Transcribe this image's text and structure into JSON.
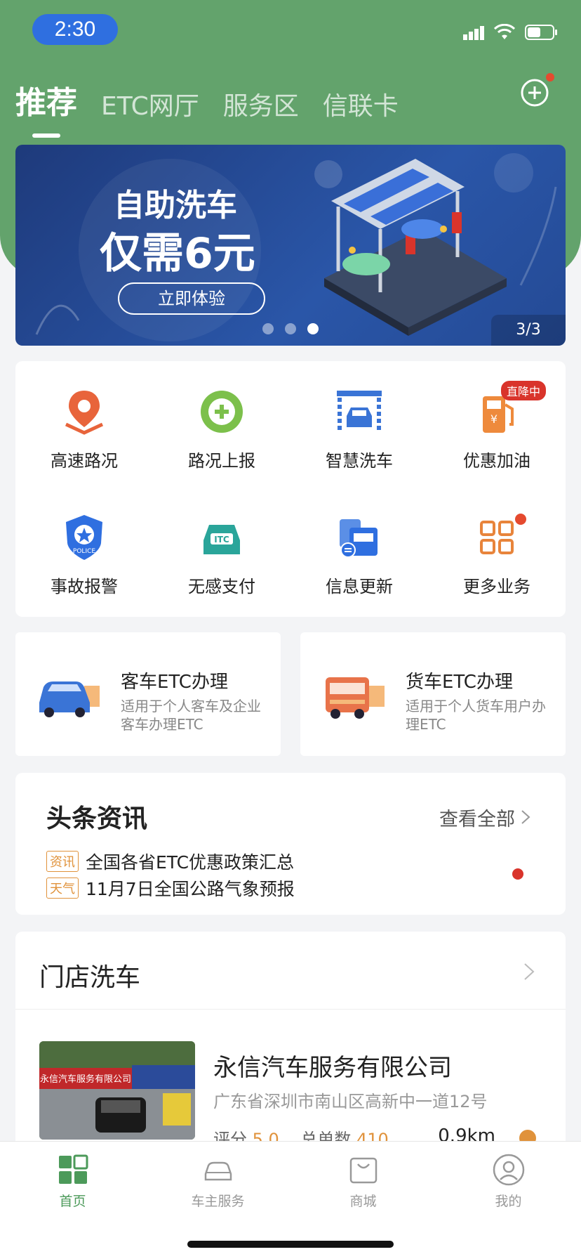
{
  "status": {
    "time": "2:30"
  },
  "tabs": [
    {
      "label": "推荐",
      "active": true
    },
    {
      "label": "ETC网厅",
      "active": false
    },
    {
      "label": "服务区",
      "active": false
    },
    {
      "label": "信联卡",
      "active": false
    }
  ],
  "banner": {
    "line1": "自助洗车",
    "line2": "仅需6元",
    "button": "立即体验",
    "page": "3/3"
  },
  "services": [
    {
      "label": "高速路况",
      "icon": "map-pin-icon"
    },
    {
      "label": "路况上报",
      "icon": "plus-circle-icon"
    },
    {
      "label": "智慧洗车",
      "icon": "car-wash-icon"
    },
    {
      "label": "优惠加油",
      "icon": "fuel-pump-icon",
      "badge": "直降中"
    },
    {
      "label": "事故报警",
      "icon": "police-badge-icon"
    },
    {
      "label": "无感支付",
      "icon": "itc-car-icon"
    },
    {
      "label": "信息更新",
      "icon": "info-update-icon"
    },
    {
      "label": "更多业务",
      "icon": "grid-more-icon"
    }
  ],
  "etc": {
    "car": {
      "title": "客车ETC办理",
      "desc": "适用于个人客车及企业客车办理ETC"
    },
    "truck": {
      "title": "货车ETC办理",
      "desc": "适用于个人货车用户办理ETC"
    }
  },
  "news": {
    "title": "头条资讯",
    "view_all": "查看全部",
    "items": [
      {
        "tag": "资讯",
        "text": "全国各省ETC优惠政策汇总"
      },
      {
        "tag": "天气",
        "text": "11月7日全国公路气象预报"
      }
    ]
  },
  "store": {
    "title": "门店洗车",
    "name": "永信汽车服务有限公司",
    "address": "广东省深圳市南山区高新中一道12号",
    "score_label": "评分",
    "score": "5.0",
    "orders_label": "总单数",
    "orders": "410",
    "distance": "0.9km",
    "sign_text": "永信汽车服务有限公司"
  },
  "bottom_nav": [
    {
      "label": "首页",
      "active": true
    },
    {
      "label": "车主服务",
      "active": false
    },
    {
      "label": "商城",
      "active": false
    },
    {
      "label": "我的",
      "active": false
    }
  ],
  "colors": {
    "green": "#63a36c",
    "accent_orange": "#e0923b",
    "badge_red": "#d9342b",
    "banner_blue": "#2a56a8"
  }
}
